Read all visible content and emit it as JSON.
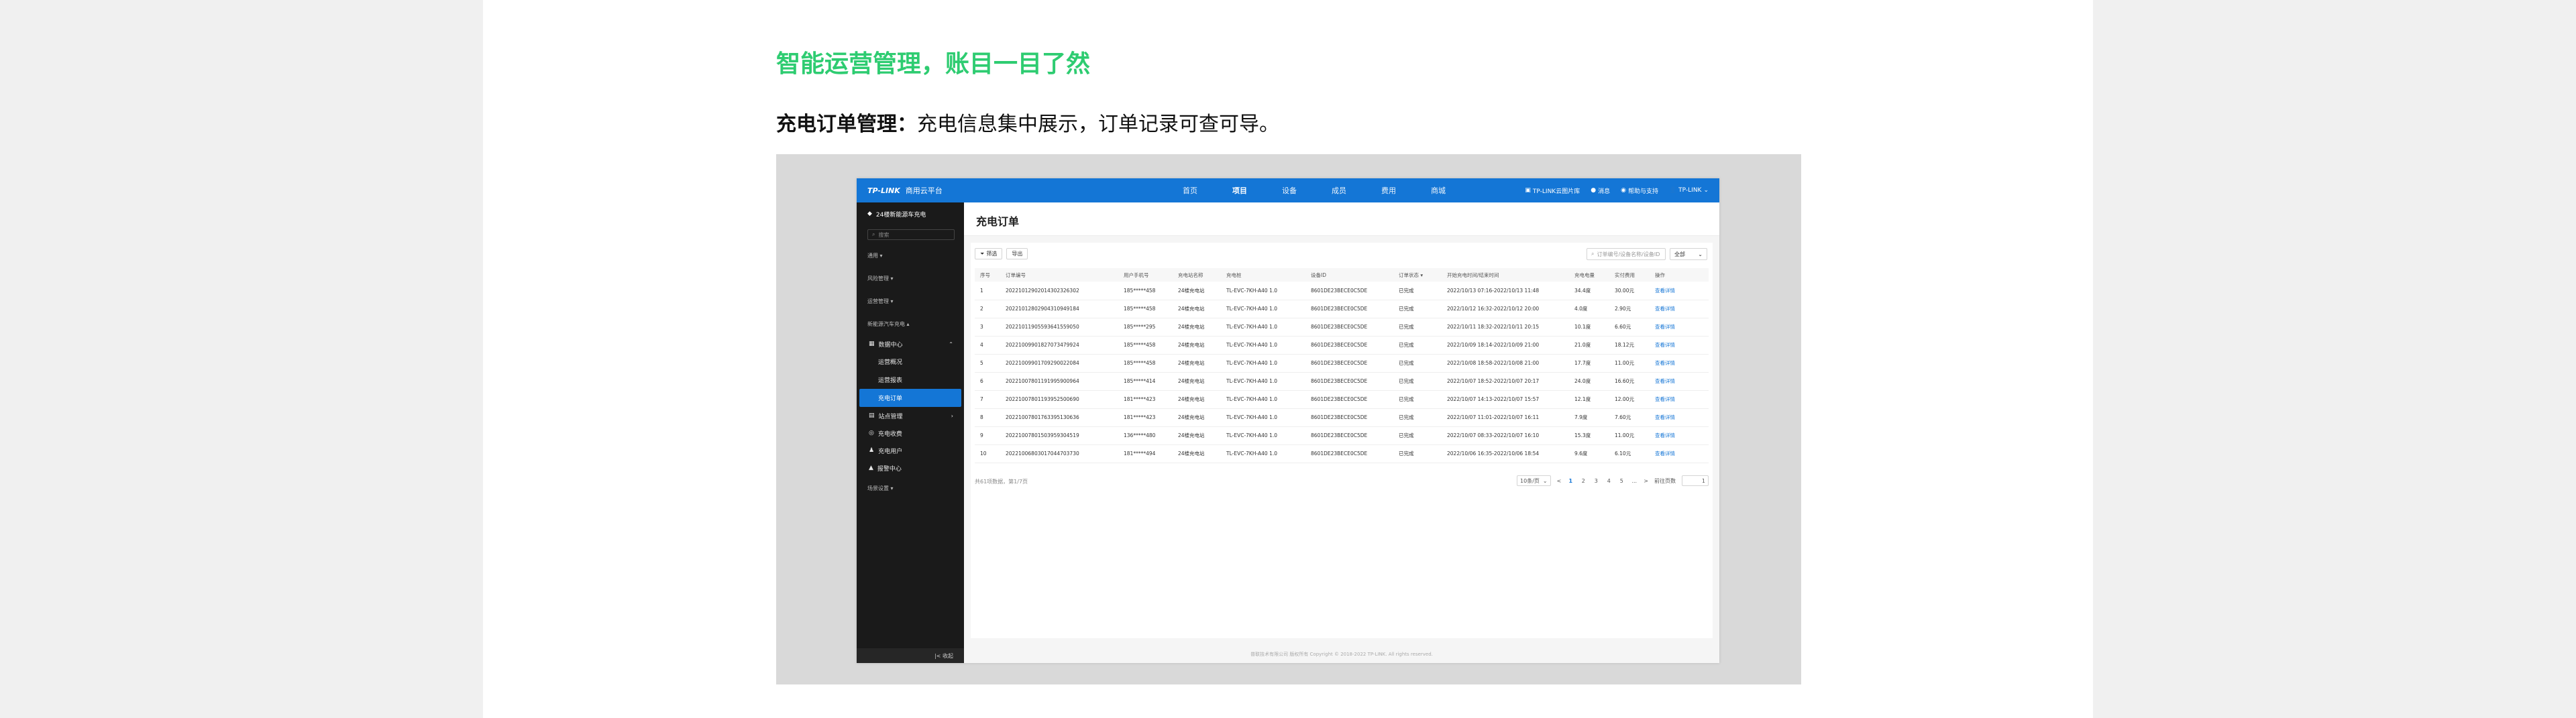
{
  "headline": "智能运营管理，账目一目了然",
  "intro": {
    "bold": "充电订单管理：",
    "rest": "充电信息集中展示，订单记录可查可导。"
  },
  "app": {
    "brand": {
      "logo": "TP-LINK",
      "name": "商用云平台"
    },
    "nav": [
      "首页",
      "项目",
      "设备",
      "成员",
      "费用",
      "商城"
    ],
    "nav_active": 1,
    "top_right": {
      "cloud": "TP-LINK云图片库",
      "msg": "消息",
      "help": "帮助与支持",
      "user": "TP-LINK"
    },
    "sidebar": {
      "site": "24楼新能源车充电",
      "search_placeholder": "搜索",
      "groups": [
        "通用",
        "风险管理",
        "运营管理",
        "新能源汽车充电"
      ],
      "data_center": "数据中心",
      "subs": [
        "运营概况",
        "运营报表",
        "充电订单"
      ],
      "menus": [
        "站点管理",
        "充电收费",
        "充电用户",
        "报警中心"
      ],
      "settings": "场景设置",
      "collapse": "收起"
    },
    "page_title": "充电订单",
    "toolbar": {
      "filter": "筛选",
      "export": "导出"
    },
    "search_placeholder": "订单编号/设备名称/设备ID",
    "filter_select": "全部",
    "columns": [
      "序号",
      "订单编号",
      "用户手机号",
      "充电站名称",
      "充电桩",
      "设备ID",
      "订单状态 ▾",
      "开始充电时间/结束时间",
      "充电电量",
      "实付费用",
      "操作"
    ],
    "rows": [
      [
        "1",
        "20221012902014302326302",
        "185*****458",
        "24楼充电站",
        "TL-EVC-7KH-A40 1.0",
        "8601DE23BECE0C5DE",
        "已完成",
        "2022/10/13 07:16-2022/10/13 11:48",
        "34.4度",
        "30.00元",
        "查看详情"
      ],
      [
        "2",
        "20221012802904310949184",
        "185*****458",
        "24楼充电站",
        "TL-EVC-7KH-A40 1.0",
        "8601DE23BECE0C5DE",
        "已完成",
        "2022/10/12 16:32-2022/10/12 20:00",
        "4.0度",
        "2.90元",
        "查看详情"
      ],
      [
        "3",
        "20221011905593641559050",
        "185*****295",
        "24楼充电站",
        "TL-EVC-7KH-A40 1.0",
        "8601DE23BECE0C5DE",
        "已完成",
        "2022/10/11 18:32-2022/10/11 20:15",
        "10.1度",
        "6.60元",
        "查看详情"
      ],
      [
        "4",
        "20221009901827073479924",
        "185*****458",
        "24楼充电站",
        "TL-EVC-7KH-A40 1.0",
        "8601DE23BECE0C5DE",
        "已完成",
        "2022/10/09 18:14-2022/10/09 21:00",
        "21.0度",
        "18.12元",
        "查看详情"
      ],
      [
        "5",
        "20221009901709290022084",
        "185*****458",
        "24楼充电站",
        "TL-EVC-7KH-A40 1.0",
        "8601DE23BECE0C5DE",
        "已完成",
        "2022/10/08 18:58-2022/10/08 21:00",
        "17.7度",
        "11.00元",
        "查看详情"
      ],
      [
        "6",
        "20221007801191995900964",
        "185*****414",
        "24楼充电站",
        "TL-EVC-7KH-A40 1.0",
        "8601DE23BECE0C5DE",
        "已完成",
        "2022/10/07 18:52-2022/10/07 20:17",
        "24.0度",
        "16.60元",
        "查看详情"
      ],
      [
        "7",
        "20221007801193952500690",
        "181*****423",
        "24楼充电站",
        "TL-EVC-7KH-A40 1.0",
        "8601DE23BECE0C5DE",
        "已完成",
        "2022/10/07 14:13-2022/10/07 15:57",
        "12.1度",
        "12.00元",
        "查看详情"
      ],
      [
        "8",
        "20221007801763395130636",
        "181*****423",
        "24楼充电站",
        "TL-EVC-7KH-A40 1.0",
        "8601DE23BECE0C5DE",
        "已完成",
        "2022/10/07 11:01-2022/10/07 16:11",
        "7.9度",
        "7.60元",
        "查看详情"
      ],
      [
        "9",
        "20221007801503959304519",
        "136*****480",
        "24楼充电站",
        "TL-EVC-7KH-A40 1.0",
        "8601DE23BECE0C5DE",
        "已完成",
        "2022/10/07 08:33-2022/10/07 16:10",
        "15.3度",
        "11.00元",
        "查看详情"
      ],
      [
        "10",
        "20221006803017044703730",
        "181*****494",
        "24楼充电站",
        "TL-EVC-7KH-A40 1.0",
        "8601DE23BECE0C5DE",
        "已完成",
        "2022/10/06 16:35-2022/10/06 18:54",
        "9.6度",
        "6.10元",
        "查看详情"
      ]
    ],
    "pager": {
      "summary": "共61项数据，第1/7页",
      "page_size": "10条/页",
      "prev": "<",
      "pages": [
        "1",
        "2",
        "3",
        "4",
        "5",
        "..."
      ],
      "next": ">",
      "jump_label": "前往页数",
      "jump_value": "1"
    },
    "footer": "普联技术有限公司 版权所有 Copyright © 2018-2022 TP-LINK. All rights reserved."
  }
}
